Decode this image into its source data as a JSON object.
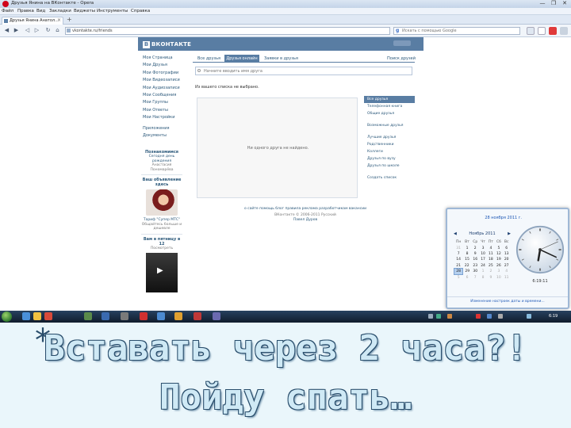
{
  "window": {
    "title": "Друзья Янина на ВКонтакте - Opera",
    "controls": [
      "—",
      "❐",
      "✕"
    ]
  },
  "menu": [
    "Файл",
    "Правка",
    "Вид",
    "Закладки",
    "Виджеты",
    "Инструменты",
    "Справка"
  ],
  "tab": {
    "label": "Друзья Янина Анатол..."
  },
  "address": {
    "url": "vkontakte.ru/friends",
    "search_placeholder": "Искать с помощью Google"
  },
  "vk": {
    "logo_text": "ВКОНТАКТЕ",
    "left_menu": [
      "Моя Страница",
      "Мои Друзья",
      "Мои Фотографии",
      "Мои Видеозаписи",
      "Мои Аудиозаписи",
      "Мои Сообщения",
      "Мои Группы",
      "Мои Ответы",
      "Мои Настройки"
    ],
    "left_extra": [
      "Приложения",
      "Документы"
    ],
    "ads": [
      {
        "title": "Познакомимся",
        "text": "Сегодня день рождения",
        "sub": "Анастасия Пономарёва"
      },
      {
        "title": "Ваш объявление здесь",
        "text": "Тариф \"Супер МТС\"",
        "sub": "Общайтесь больше и дешевле"
      },
      {
        "title": "Вам в пятницу в 12",
        "text": "",
        "sub": "Посмотреть"
      }
    ],
    "tabs": [
      "Все друзья",
      "Друзья онлайн",
      "Заявки в друзья",
      "Поиск друзей"
    ],
    "search_placeholder": "Начните вводить имя друга",
    "no_friends_head": "Из вашего списка не выбрано.",
    "empty_message": "Ни одного друга не найдено.",
    "right_menu": [
      "Все друзья",
      "Телефонная книга",
      "Общие друзья",
      "Возможные друзья",
      "Лучшие друзья",
      "Родственники",
      "Коллеги",
      "Друзья по вузу",
      "Друзья по школе",
      "Создать список"
    ],
    "footer_links": "о сайте  помощь  блог  правила  реклама  разработчикам  вакансии",
    "copyright": "ВКонтакте © 2006-2011 Русский",
    "lang": "Павел Дуров"
  },
  "clock": {
    "date_link": "28 ноября 2011 г.",
    "month": "Ноябрь 2011",
    "weekdays": [
      "Пн",
      "Вт",
      "Ср",
      "Чт",
      "Пт",
      "Сб",
      "Вс"
    ],
    "weeks": [
      [
        "31",
        "1",
        "2",
        "3",
        "4",
        "5",
        "6"
      ],
      [
        "7",
        "8",
        "9",
        "10",
        "11",
        "12",
        "13"
      ],
      [
        "14",
        "15",
        "16",
        "17",
        "18",
        "19",
        "20"
      ],
      [
        "21",
        "22",
        "23",
        "24",
        "25",
        "26",
        "27"
      ],
      [
        "28",
        "29",
        "30",
        "1",
        "2",
        "3",
        "4"
      ],
      [
        "5",
        "6",
        "7",
        "8",
        "9",
        "10",
        "11"
      ]
    ],
    "today": "28",
    "time": "6:19:11",
    "settings_link": "Изменение настроек даты и времени...",
    "hour": 6,
    "minute": 19,
    "second": 11
  },
  "taskbar": {
    "time": "6:19"
  },
  "caption": {
    "line1": "Вставать через 2 часа?!",
    "line2": "Пойду спать…",
    "bullet": "*"
  },
  "colors": {
    "vk_blue": "#597da3",
    "vk_link": "#2b587a",
    "caption_fill": "#cfe9f5",
    "caption_outline": "#2a4e6c"
  }
}
